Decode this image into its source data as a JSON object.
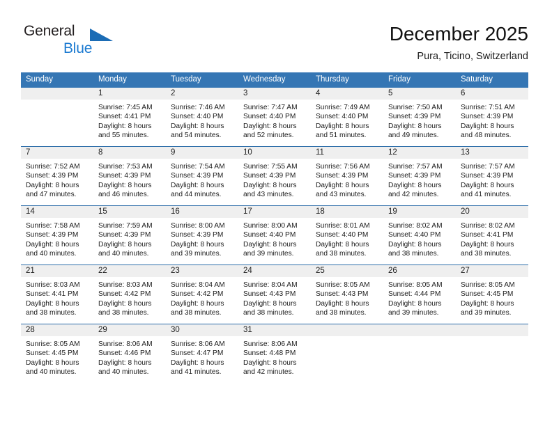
{
  "brand": {
    "name_top": "General",
    "name_bottom": "Blue",
    "triangle_color": "#1b6cb5",
    "blue_text_color": "#1b7ad1"
  },
  "header": {
    "title": "December 2025",
    "location": "Pura, Ticino, Switzerland"
  },
  "colors": {
    "header_blue": "#3576b4",
    "row_divider": "#2b6ca8",
    "daynum_band": "#efefef"
  },
  "calendar": {
    "weekday_headers": [
      "Sunday",
      "Monday",
      "Tuesday",
      "Wednesday",
      "Thursday",
      "Friday",
      "Saturday"
    ],
    "weeks": [
      [
        {
          "day": "",
          "blank": true,
          "sunrise": "",
          "sunset": "",
          "daylight_1": "",
          "daylight_2": ""
        },
        {
          "day": "1",
          "sunrise": "Sunrise: 7:45 AM",
          "sunset": "Sunset: 4:41 PM",
          "daylight_1": "Daylight: 8 hours",
          "daylight_2": "and 55 minutes."
        },
        {
          "day": "2",
          "sunrise": "Sunrise: 7:46 AM",
          "sunset": "Sunset: 4:40 PM",
          "daylight_1": "Daylight: 8 hours",
          "daylight_2": "and 54 minutes."
        },
        {
          "day": "3",
          "sunrise": "Sunrise: 7:47 AM",
          "sunset": "Sunset: 4:40 PM",
          "daylight_1": "Daylight: 8 hours",
          "daylight_2": "and 52 minutes."
        },
        {
          "day": "4",
          "sunrise": "Sunrise: 7:49 AM",
          "sunset": "Sunset: 4:40 PM",
          "daylight_1": "Daylight: 8 hours",
          "daylight_2": "and 51 minutes."
        },
        {
          "day": "5",
          "sunrise": "Sunrise: 7:50 AM",
          "sunset": "Sunset: 4:39 PM",
          "daylight_1": "Daylight: 8 hours",
          "daylight_2": "and 49 minutes."
        },
        {
          "day": "6",
          "sunrise": "Sunrise: 7:51 AM",
          "sunset": "Sunset: 4:39 PM",
          "daylight_1": "Daylight: 8 hours",
          "daylight_2": "and 48 minutes."
        }
      ],
      [
        {
          "day": "7",
          "sunrise": "Sunrise: 7:52 AM",
          "sunset": "Sunset: 4:39 PM",
          "daylight_1": "Daylight: 8 hours",
          "daylight_2": "and 47 minutes."
        },
        {
          "day": "8",
          "sunrise": "Sunrise: 7:53 AM",
          "sunset": "Sunset: 4:39 PM",
          "daylight_1": "Daylight: 8 hours",
          "daylight_2": "and 46 minutes."
        },
        {
          "day": "9",
          "sunrise": "Sunrise: 7:54 AM",
          "sunset": "Sunset: 4:39 PM",
          "daylight_1": "Daylight: 8 hours",
          "daylight_2": "and 44 minutes."
        },
        {
          "day": "10",
          "sunrise": "Sunrise: 7:55 AM",
          "sunset": "Sunset: 4:39 PM",
          "daylight_1": "Daylight: 8 hours",
          "daylight_2": "and 43 minutes."
        },
        {
          "day": "11",
          "sunrise": "Sunrise: 7:56 AM",
          "sunset": "Sunset: 4:39 PM",
          "daylight_1": "Daylight: 8 hours",
          "daylight_2": "and 43 minutes."
        },
        {
          "day": "12",
          "sunrise": "Sunrise: 7:57 AM",
          "sunset": "Sunset: 4:39 PM",
          "daylight_1": "Daylight: 8 hours",
          "daylight_2": "and 42 minutes."
        },
        {
          "day": "13",
          "sunrise": "Sunrise: 7:57 AM",
          "sunset": "Sunset: 4:39 PM",
          "daylight_1": "Daylight: 8 hours",
          "daylight_2": "and 41 minutes."
        }
      ],
      [
        {
          "day": "14",
          "sunrise": "Sunrise: 7:58 AM",
          "sunset": "Sunset: 4:39 PM",
          "daylight_1": "Daylight: 8 hours",
          "daylight_2": "and 40 minutes."
        },
        {
          "day": "15",
          "sunrise": "Sunrise: 7:59 AM",
          "sunset": "Sunset: 4:39 PM",
          "daylight_1": "Daylight: 8 hours",
          "daylight_2": "and 40 minutes."
        },
        {
          "day": "16",
          "sunrise": "Sunrise: 8:00 AM",
          "sunset": "Sunset: 4:39 PM",
          "daylight_1": "Daylight: 8 hours",
          "daylight_2": "and 39 minutes."
        },
        {
          "day": "17",
          "sunrise": "Sunrise: 8:00 AM",
          "sunset": "Sunset: 4:40 PM",
          "daylight_1": "Daylight: 8 hours",
          "daylight_2": "and 39 minutes."
        },
        {
          "day": "18",
          "sunrise": "Sunrise: 8:01 AM",
          "sunset": "Sunset: 4:40 PM",
          "daylight_1": "Daylight: 8 hours",
          "daylight_2": "and 38 minutes."
        },
        {
          "day": "19",
          "sunrise": "Sunrise: 8:02 AM",
          "sunset": "Sunset: 4:40 PM",
          "daylight_1": "Daylight: 8 hours",
          "daylight_2": "and 38 minutes."
        },
        {
          "day": "20",
          "sunrise": "Sunrise: 8:02 AM",
          "sunset": "Sunset: 4:41 PM",
          "daylight_1": "Daylight: 8 hours",
          "daylight_2": "and 38 minutes."
        }
      ],
      [
        {
          "day": "21",
          "sunrise": "Sunrise: 8:03 AM",
          "sunset": "Sunset: 4:41 PM",
          "daylight_1": "Daylight: 8 hours",
          "daylight_2": "and 38 minutes."
        },
        {
          "day": "22",
          "sunrise": "Sunrise: 8:03 AM",
          "sunset": "Sunset: 4:42 PM",
          "daylight_1": "Daylight: 8 hours",
          "daylight_2": "and 38 minutes."
        },
        {
          "day": "23",
          "sunrise": "Sunrise: 8:04 AM",
          "sunset": "Sunset: 4:42 PM",
          "daylight_1": "Daylight: 8 hours",
          "daylight_2": "and 38 minutes."
        },
        {
          "day": "24",
          "sunrise": "Sunrise: 8:04 AM",
          "sunset": "Sunset: 4:43 PM",
          "daylight_1": "Daylight: 8 hours",
          "daylight_2": "and 38 minutes."
        },
        {
          "day": "25",
          "sunrise": "Sunrise: 8:05 AM",
          "sunset": "Sunset: 4:43 PM",
          "daylight_1": "Daylight: 8 hours",
          "daylight_2": "and 38 minutes."
        },
        {
          "day": "26",
          "sunrise": "Sunrise: 8:05 AM",
          "sunset": "Sunset: 4:44 PM",
          "daylight_1": "Daylight: 8 hours",
          "daylight_2": "and 39 minutes."
        },
        {
          "day": "27",
          "sunrise": "Sunrise: 8:05 AM",
          "sunset": "Sunset: 4:45 PM",
          "daylight_1": "Daylight: 8 hours",
          "daylight_2": "and 39 minutes."
        }
      ],
      [
        {
          "day": "28",
          "sunrise": "Sunrise: 8:05 AM",
          "sunset": "Sunset: 4:45 PM",
          "daylight_1": "Daylight: 8 hours",
          "daylight_2": "and 40 minutes."
        },
        {
          "day": "29",
          "sunrise": "Sunrise: 8:06 AM",
          "sunset": "Sunset: 4:46 PM",
          "daylight_1": "Daylight: 8 hours",
          "daylight_2": "and 40 minutes."
        },
        {
          "day": "30",
          "sunrise": "Sunrise: 8:06 AM",
          "sunset": "Sunset: 4:47 PM",
          "daylight_1": "Daylight: 8 hours",
          "daylight_2": "and 41 minutes."
        },
        {
          "day": "31",
          "sunrise": "Sunrise: 8:06 AM",
          "sunset": "Sunset: 4:48 PM",
          "daylight_1": "Daylight: 8 hours",
          "daylight_2": "and 42 minutes."
        },
        {
          "day": "",
          "blank": true,
          "sunrise": "",
          "sunset": "",
          "daylight_1": "",
          "daylight_2": ""
        },
        {
          "day": "",
          "blank": true,
          "sunrise": "",
          "sunset": "",
          "daylight_1": "",
          "daylight_2": ""
        },
        {
          "day": "",
          "blank": true,
          "sunrise": "",
          "sunset": "",
          "daylight_1": "",
          "daylight_2": ""
        }
      ]
    ]
  }
}
